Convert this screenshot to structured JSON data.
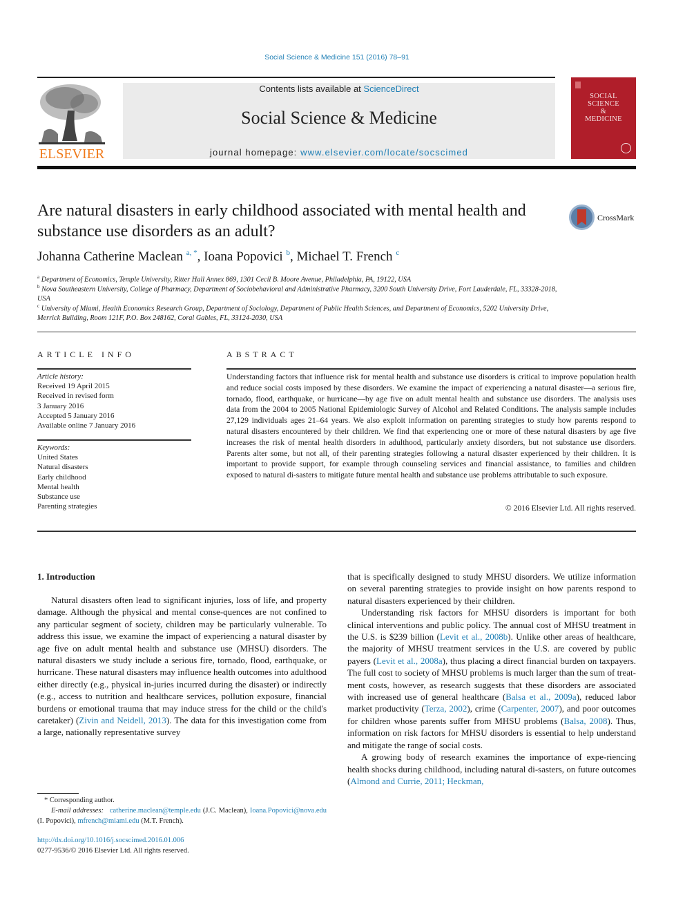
{
  "journal_ref": "Social Science & Medicine 151 (2016) 78–91",
  "header": {
    "publisher_logo_text": "ELSEVIER",
    "contents_prefix": "Contents lists available at ",
    "contents_link": "ScienceDirect",
    "journal_title": "Social Science & Medicine",
    "homepage_prefix": "journal homepage: ",
    "homepage_link": "www.elsevier.com/locate/socscimed",
    "cover_lines": [
      "SOCIAL",
      "SCIENCE",
      "&",
      "MEDICINE"
    ],
    "colors": {
      "link": "#1f7fb5",
      "elsevier_orange": "#f07a1a",
      "cover_red": "#b01e2a"
    }
  },
  "article": {
    "title": "Are natural disasters in early childhood associated with mental health and substance use disorders as an adult?",
    "crossmark_label": "CrossMark",
    "authors": [
      {
        "name": "Johanna Catherine Maclean",
        "sup": "a, *"
      },
      {
        "name": "Ioana Popovici",
        "sup": "b"
      },
      {
        "name": "Michael T. French",
        "sup": "c"
      }
    ],
    "affiliations": [
      {
        "mark": "a",
        "text": "Department of Economics, Temple University, Ritter Hall Annex 869, 1301 Cecil B. Moore Avenue, Philadelphia, PA, 19122, USA"
      },
      {
        "mark": "b",
        "text": "Nova Southeastern University, College of Pharmacy, Department of Sociobehavioral and Administrative Pharmacy, 3200 South University Drive, Fort Lauderdale, FL, 33328-2018, USA"
      },
      {
        "mark": "c",
        "text": "University of Miami, Health Economics Research Group, Department of Sociology, Department of Public Health Sciences, and Department of Economics, 5202 University Drive, Merrick Building, Room 121F, P.O. Box 248162, Coral Gables, FL, 33124-2030, USA"
      }
    ]
  },
  "article_info": {
    "heading": "ARTICLE INFO",
    "history_label": "Article history:",
    "history": [
      "Received 19 April 2015",
      "Received in revised form",
      "3 January 2016",
      "Accepted 5 January 2016",
      "Available online 7 January 2016"
    ],
    "keywords_label": "Keywords:",
    "keywords": [
      "United States",
      "Natural disasters",
      "Early childhood",
      "Mental health",
      "Substance use",
      "Parenting strategies"
    ]
  },
  "abstract": {
    "heading": "ABSTRACT",
    "text": "Understanding factors that influence risk for mental health and substance use disorders is critical to improve population health and reduce social costs imposed by these disorders. We examine the impact of experiencing a natural disaster—a serious fire, tornado, flood, earthquake, or hurricane—by age five on adult mental health and substance use disorders. The analysis uses data from the 2004 to 2005 National Epidemiologic Survey of Alcohol and Related Conditions. The analysis sample includes 27,129 individuals ages 21–64 years. We also exploit information on parenting strategies to study how parents respond to natural disasters encountered by their children. We find that experiencing one or more of these natural disasters by age five increases the risk of mental health disorders in adulthood, particularly anxiety disorders, but not substance use disorders. Parents alter some, but not all, of their parenting strategies following a natural disaster experienced by their children. It is important to provide support, for example through counseling services and financial assistance, to families and children exposed to natural di-sasters to mitigate future mental health and substance use problems attributable to such exposure.",
    "copyright": "© 2016 Elsevier Ltd. All rights reserved."
  },
  "body": {
    "section_heading": "1.  Introduction",
    "left_p1_a": "Natural disasters often lead to significant injuries, loss of life, and property damage. Although the physical and mental conse-quences are not confined to any particular segment of society, children may be particularly vulnerable. To address this issue, we examine the impact of experiencing a natural disaster by age five on adult mental health and substance use (MHSU) disorders. The natural disasters we study include a serious fire, tornado, flood, earthquake, or hurricane. These natural disasters may influence health outcomes into adulthood either directly (e.g., physical in-juries incurred during the disaster) or indirectly (e.g., access to nutrition and healthcare services, pollution exposure, financial burdens or emotional trauma that may induce stress for the child or the child's caretaker) (",
    "left_p1_cite": "Zivin and Neidell, 2013",
    "left_p1_b": "). The data for this investigation come from a large, nationally representative survey",
    "right_p1": "that is specifically designed to study MHSU disorders. We utilize information on several parenting strategies to provide insight on how parents respond to natural disasters experienced by their children.",
    "right_p2": [
      {
        "t": "Understanding risk factors for MHSU disorders is important for both clinical interventions and public policy. The annual cost of MHSU treatment in the U.S. is $239 billion ("
      },
      {
        "c": "Levit et al., 2008b"
      },
      {
        "t": "). Unlike other areas of healthcare, the majority of MHSU treatment services in the U.S. are covered by public payers ("
      },
      {
        "c": "Levit et al., 2008a"
      },
      {
        "t": "), thus placing a direct financial burden on taxpayers. The full cost to society of MHSU problems is much larger than the sum of treat-ment costs, however, as research suggests that these disorders are associated with increased use of general healthcare ("
      },
      {
        "c": "Balsa et al., 2009a"
      },
      {
        "t": "), reduced labor market productivity ("
      },
      {
        "c": "Terza, 2002"
      },
      {
        "t": "), crime ("
      },
      {
        "c": "Carpenter, 2007"
      },
      {
        "t": "), and poor outcomes for children whose parents suffer from MHSU problems ("
      },
      {
        "c": "Balsa, 2008"
      },
      {
        "t": "). Thus, information on risk factors for MHSU disorders is essential to help understand and mitigate the range of social costs."
      }
    ],
    "right_p3_a": "A growing body of research examines the importance of expe-riencing health shocks during childhood, including natural di-sasters, on future outcomes (",
    "right_p3_cite": "Almond and Currie, 2011; Heckman,"
  },
  "footnotes": {
    "corresponding": "* Corresponding author.",
    "email_label": "E-mail addresses:",
    "emails": [
      {
        "addr": "catherine.maclean@temple.edu",
        "who": "(J.C. Maclean),"
      },
      {
        "addr": "Ioana.Popovici@nova.edu",
        "who": "(I. Popovici),"
      },
      {
        "addr": "mfrench@miami.edu",
        "who": "(M.T. French)."
      }
    ],
    "doi": "http://dx.doi.org/10.1016/j.socscimed.2016.01.006",
    "issn": "0277-9536/© 2016 Elsevier Ltd. All rights reserved."
  }
}
